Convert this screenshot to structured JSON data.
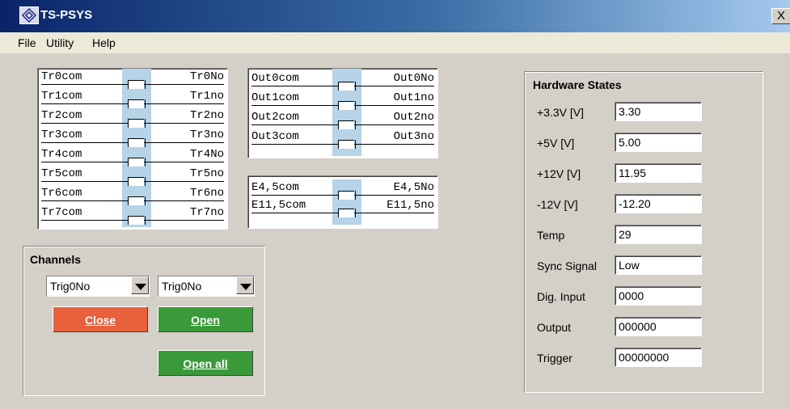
{
  "window": {
    "title": "TS-PSYS",
    "close_label": "X"
  },
  "menu": {
    "file": "File",
    "utility": "Utility",
    "help": "Help"
  },
  "trigger_relays": [
    {
      "com": "Tr0com",
      "no": "Tr0No"
    },
    {
      "com": "Tr1com",
      "no": "Tr1no"
    },
    {
      "com": "Tr2com",
      "no": "Tr2no"
    },
    {
      "com": "Tr3com",
      "no": "Tr3no"
    },
    {
      "com": "Tr4com",
      "no": "Tr4No"
    },
    {
      "com": "Tr5com",
      "no": "Tr5no"
    },
    {
      "com": "Tr6com",
      "no": "Tr6no"
    },
    {
      "com": "Tr7com",
      "no": "Tr7no"
    }
  ],
  "output_relays": [
    {
      "com": "Out0com",
      "no": "Out0No"
    },
    {
      "com": "Out1com",
      "no": "Out1no"
    },
    {
      "com": "Out2com",
      "no": "Out2no"
    },
    {
      "com": "Out3com",
      "no": "Out3no"
    }
  ],
  "e_relays": [
    {
      "com": "E4,5com",
      "no": "E4,5No"
    },
    {
      "com": "E11,5com",
      "no": "E11,5no"
    }
  ],
  "channels": {
    "title": "Channels",
    "select_left": "Trig0No",
    "select_right": "Trig0No",
    "close_label": "Close",
    "open_label": "Open",
    "open_all_label": "Open all"
  },
  "hardware": {
    "title": "Hardware States",
    "rows": [
      {
        "label": "+3.3V [V]",
        "value": "3.30"
      },
      {
        "label": "+5V [V]",
        "value": "5.00"
      },
      {
        "label": "+12V [V]",
        "value": "11.95"
      },
      {
        "label": "-12V [V]",
        "value": "-12.20"
      },
      {
        "label": "Temp",
        "value": "29"
      },
      {
        "label": "Sync Signal",
        "value": "Low"
      },
      {
        "label": "Dig. Input",
        "value": "0000"
      },
      {
        "label": "Output",
        "value": "000000"
      },
      {
        "label": "Trigger",
        "value": "00000000"
      }
    ]
  },
  "colors": {
    "close_button": "#e8603c",
    "open_button": "#3a9a3a",
    "switch_highlight": "#b6d3e7"
  }
}
